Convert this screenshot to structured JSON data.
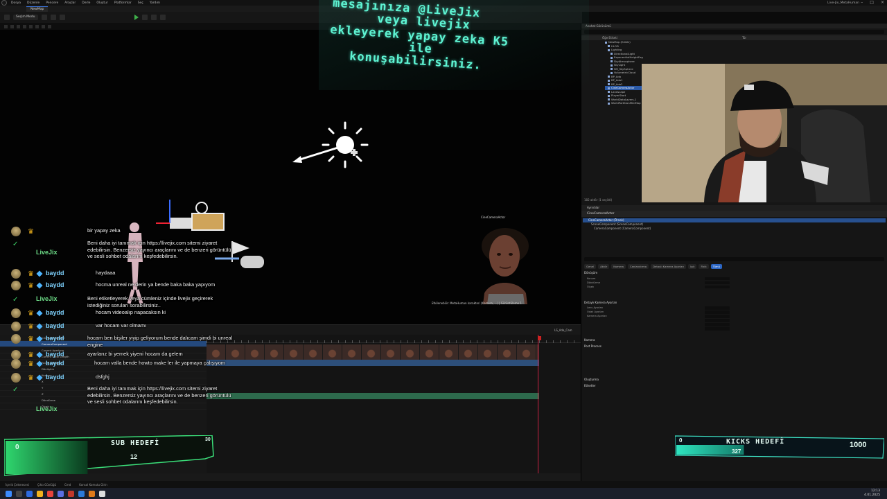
{
  "menu": {
    "items": [
      "Dosya",
      "Düzenle",
      "Pencere",
      "Araçlar",
      "Derle",
      "Oluştur",
      "Platformlar",
      "Seç",
      "Yardım"
    ],
    "project": "Live-Jix_MetaHuman",
    "tab": "NewMap"
  },
  "toolbar": {
    "mode_label": "Seçim Modu"
  },
  "ticker": {
    "line1": "mesajınıza @LiveJix",
    "line2": "veya livejix",
    "line3": "ekleyerek yapay zeka K5",
    "line4": "ile",
    "line5": "konuşabilirsiniz."
  },
  "viewport": {
    "actor_label": "CineCameraActor",
    "meta_line": "Etkilenebilir: MetaHuman karakteri (Kamera, ...) | Görüntüleme 1"
  },
  "outliner": {
    "tab": "Anahat Görünümü",
    "col_label": "Öğe Etiketi",
    "col_type": "Tür",
    "rows": [
      "NewMap (Editör)",
      "HLOD",
      "Lighting",
      "DirectionalLight",
      "ExponentialHeightFog",
      "SkyAtmosphere",
      "SkyLight",
      "SM_SkySphere",
      "VolumetricCloud",
      "BP_Ada",
      "BP_Ada1",
      "BP_Ada2",
      "CineCameraActor",
      "Landscape",
      "PlayerStart",
      "WorldDataLayers-1",
      "WorldPartitionMiniMap"
    ],
    "selected_row": "CineCameraActor",
    "count": "182 aktör (1 seçildi)"
  },
  "details": {
    "tab": "Ayrıntılar",
    "actor": "CineCameraActor",
    "components": [
      "CineCameraActor (Örnek)",
      "SceneComponent (SceneComponent)",
      "CameraComponent (CameraComponent)"
    ],
    "categories": [
      "Genel",
      "Aktör",
      "Kamera",
      "Canlandırma",
      "Detaylı Kamera Ayarları",
      "Işık",
      "Fizik",
      "Tümü"
    ],
    "active_category": "Tümü",
    "sections": [
      "Dönüşüm",
      "Konum",
      "Döndürme",
      "Ölçek",
      "Detaylı Kamera Ayarları",
      "Lens Ayarları",
      "Odak Ayarları",
      "Kamera Ayarları",
      "Kamera",
      "Post Process",
      "Oluşturma",
      "Etiketler"
    ]
  },
  "sequencer": {
    "tracks": [
      "CineCameraActor",
      "CameraComponent",
      "Current Aperture",
      "Current Focal Length",
      "Focus Settings",
      "Dönüşüm",
      "Konum",
      "X",
      "Y",
      "Z",
      "Döndürme",
      "Ölçek"
    ],
    "selected_track": "CineCameraActor",
    "sequence_name": "LS_Ada_Cam"
  },
  "chat": [
    {
      "kind": "user",
      "name": "",
      "text": "bir yapay zeka"
    },
    {
      "kind": "bot",
      "name": "LiveJix",
      "text": "Beni daha iyi tanımak için https://livejix.com sitemi ziyaret edebilirsin. Benzersiz yayıncı araçlarını ve de benzeri görüntülü ve sesli sohbet odalarını keşfedebilirsin."
    },
    {
      "kind": "user",
      "name": "baydd",
      "text": "haydaaa"
    },
    {
      "kind": "user",
      "name": "baydd",
      "text": "hocma unreal ne derin ya bende baka baka yapıyom"
    },
    {
      "kind": "bot",
      "name": "LiveJix",
      "text": "Beni etiketleyerek veya cümleniz içinde livejix geçirerek istediğiniz soruları sorabilirsiniz.."
    },
    {
      "kind": "user",
      "name": "baydd",
      "text": "hocam videoalıp napacaksın ki"
    },
    {
      "kind": "user",
      "name": "baydd",
      "text": "var hocam var olmamı"
    },
    {
      "kind": "user",
      "name": "baydd",
      "text": "hocam ben bişiler yiyip geliyorum bende dalıcam şimdi bi unreal engine"
    },
    {
      "kind": "user",
      "name": "baydd",
      "text": "ayarlarız bi yemek yiyeni hocam da gelem"
    },
    {
      "kind": "user",
      "name": "baydd",
      "text": "hocam valla bende howto make ler ile yapmaya çalışıyom"
    },
    {
      "kind": "user",
      "name": "baydd",
      "text": "dsfghj"
    },
    {
      "kind": "bot",
      "name": "LiveJix",
      "text": "Beni daha iyi tanımak için https://livejix.com sitemi ziyaret edebilirsin. Benzersiz yayıncı araçlarını ve de benzeri görüntülü ve sesli sohbet odalarını keşfedebilirsin."
    }
  ],
  "sub_goal": {
    "title": "SUB HEDEFİ",
    "start": "0",
    "current": "12",
    "target": "30",
    "fraction": 0.4
  },
  "kicks_goal": {
    "title": "KICKS HEDEFİ",
    "start": "0",
    "current": "327",
    "target": "1000",
    "fraction": 0.327
  },
  "statusbar": {
    "items": [
      "İçerik Çekmecesi",
      "Çıktı Günlüğü",
      "Cmd",
      "Konsol Komutu Girin"
    ]
  },
  "clock": {
    "time": "12:13",
    "date": "4.01.2025"
  },
  "colors": {
    "accent": "#2c66c4",
    "overlay_cyan": "#5ef3d2",
    "chat_name": "#7fd3ff",
    "bot_green": "#6fe08a",
    "crown": "#f2b51d"
  }
}
